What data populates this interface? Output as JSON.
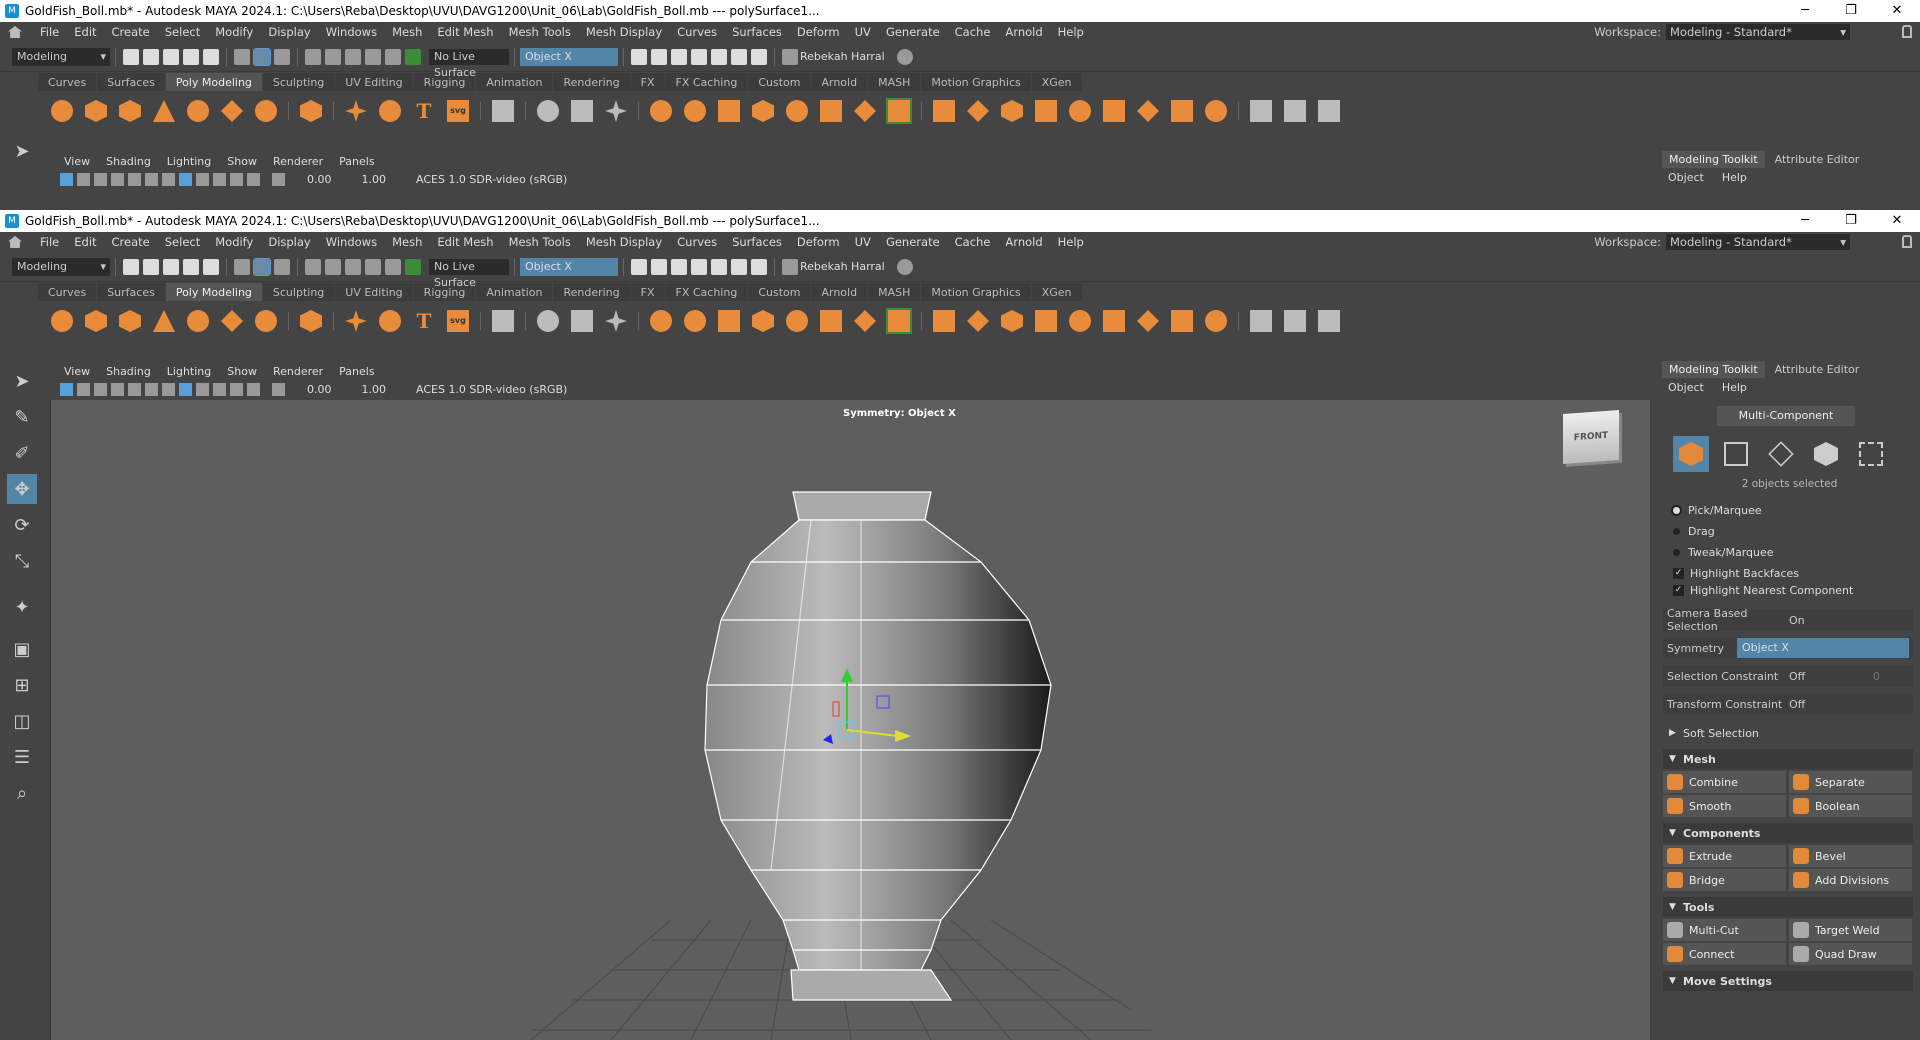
{
  "window": {
    "title": "GoldFish_Boll.mb* - Autodesk MAYA 2024.1: C:\\Users\\Reba\\Desktop\\UVU\\DAVG1200\\Unit_06\\Lab\\GoldFish_Boll.mb   ---   polySurface1...",
    "controls": [
      "─",
      "❐",
      "✕"
    ]
  },
  "menus": [
    "File",
    "Edit",
    "Create",
    "Select",
    "Modify",
    "Display",
    "Windows",
    "Mesh",
    "Edit Mesh",
    "Mesh Tools",
    "Mesh Display",
    "Curves",
    "Surfaces",
    "Deform",
    "UV",
    "Generate",
    "Cache",
    "Arnold",
    "Help"
  ],
  "workspace": {
    "label": "Workspace:",
    "value": "Modeling - Standard*"
  },
  "statusline": {
    "menuset": "Modeling",
    "live_surface": "No Live Surface",
    "symmetry": "Object X",
    "user": "Rebekah Harral"
  },
  "shelf_tabs": [
    "Curves",
    "Surfaces",
    "Poly Modeling",
    "Sculpting",
    "UV Editing",
    "Rigging",
    "Animation",
    "Rendering",
    "FX",
    "FX Caching",
    "Custom",
    "Arnold",
    "MASH",
    "Motion Graphics",
    "XGen"
  ],
  "shelf_active": "Poly Modeling",
  "shelf_svg_label": "svg",
  "shelf_text_label": "T",
  "panel_menu": [
    "View",
    "Shading",
    "Lighting",
    "Show",
    "Renderer",
    "Panels"
  ],
  "panel_toolbar": {
    "near": "0.00",
    "gamma": "1.00",
    "colorspace": "ACES 1.0 SDR-video (sRGB)"
  },
  "viewport": {
    "symmetry_label": "Symmetry: Object X",
    "viewcube": "FRONT"
  },
  "toolkit": {
    "tabs": [
      "Modeling Toolkit",
      "Attribute Editor"
    ],
    "sub": [
      "Object",
      "Help"
    ],
    "multi_component": "Multi-Component",
    "selected": "2 objects selected",
    "radios": [
      "Pick/Marquee",
      "Drag",
      "Tweak/Marquee"
    ],
    "checks": [
      "Highlight Backfaces",
      "Highlight Nearest Component"
    ],
    "camera_sel": {
      "label": "Camera Based Selection",
      "value": "On"
    },
    "symmetry": {
      "label": "Symmetry",
      "value": "Object X"
    },
    "sel_constraint": {
      "label": "Selection Constraint",
      "value": "Off",
      "num": "0"
    },
    "xform_constraint": {
      "label": "Transform Constraint",
      "value": "Off"
    },
    "soft_selection": "Soft Selection",
    "mesh": {
      "title": "Mesh",
      "buttons": [
        "Combine",
        "Separate",
        "Smooth",
        "Boolean"
      ]
    },
    "components": {
      "title": "Components",
      "buttons": [
        "Extrude",
        "Bevel",
        "Bridge",
        "Add Divisions"
      ]
    },
    "tools": {
      "title": "Tools",
      "buttons": [
        "Multi-Cut",
        "Target Weld",
        "Connect",
        "Quad Draw"
      ]
    },
    "move_settings": "Move Settings"
  },
  "colors": {
    "accent": "#5285a6",
    "shelf_orange": "#e88b3b",
    "viewport_bg": "#5e5e5e"
  }
}
